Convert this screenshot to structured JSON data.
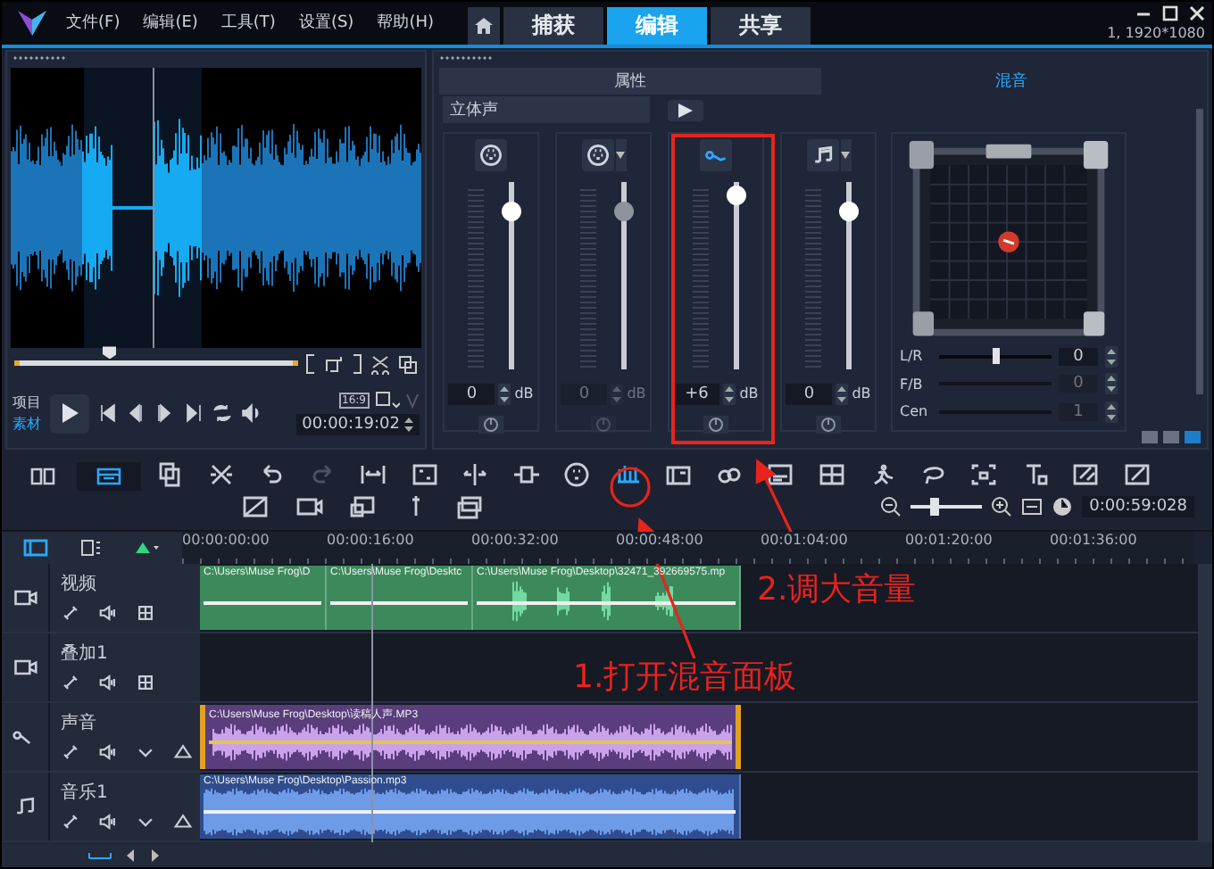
{
  "menu": [
    {
      "label": "文件(F)"
    },
    {
      "label": "编辑(E)"
    },
    {
      "label": "工具(T)"
    },
    {
      "label": "设置(S)"
    },
    {
      "label": "帮助(H)"
    }
  ],
  "tabs": [
    {
      "label": "捕获",
      "selected": false
    },
    {
      "label": "编辑",
      "selected": true
    },
    {
      "label": "共享",
      "selected": false
    }
  ],
  "project_info": "1, 1920*1080",
  "preview": {
    "sources": [
      {
        "label": "项目",
        "selected": false
      },
      {
        "label": "素材",
        "selected": true
      }
    ],
    "scrub": {
      "level": 0.33
    },
    "aspect": "16:9",
    "timecode": "00:00:19:02"
  },
  "mixer": {
    "tabs": [
      {
        "label": "属性",
        "selected": false
      },
      {
        "label": "混音",
        "selected": true
      }
    ],
    "channel_mode": "立体声",
    "channels": [
      {
        "kind": "video",
        "level": 0.84,
        "value": "0",
        "unit": "dB",
        "disabled": false
      },
      {
        "kind": "overlay",
        "level": 0.84,
        "value": "0",
        "unit": "dB",
        "disabled": true
      },
      {
        "kind": "voice",
        "level": 0.92,
        "value": "+6",
        "unit": "dB",
        "disabled": false
      },
      {
        "kind": "music",
        "level": 0.84,
        "value": "0",
        "unit": "dB",
        "disabled": false
      }
    ],
    "surround": [
      {
        "label": "L/R",
        "value": "0",
        "disabled": false,
        "level": 0.5
      },
      {
        "label": "F/B",
        "value": "0",
        "disabled": true
      },
      {
        "label": "Cen",
        "value": "1",
        "disabled": true
      }
    ]
  },
  "views": [
    {
      "kind": "storyboard",
      "selected": false
    },
    {
      "kind": "timeline",
      "selected": true
    }
  ],
  "timeline": {
    "zoom": {
      "level": 0.34
    },
    "duration": "0:00:59:028",
    "ruler": [
      "00:00:00:00",
      "00:00:16:00",
      "00:00:32:00",
      "00:00:48:00",
      "00:01:04:00",
      "00:01:20:00",
      "00:01:36:00"
    ],
    "tracks": [
      {
        "name": "视频",
        "kind": "video",
        "clips": [
          {
            "label": "C:\\Users\\Muse Frog\\D",
            "selected": false
          },
          {
            "label": "C:\\Users\\Muse Frog\\Desktc",
            "selected": false
          },
          {
            "label": "C:\\Users\\Muse Frog\\Desktop\\32471_392669575.mp",
            "selected": false
          }
        ]
      },
      {
        "name": "叠加1",
        "kind": "overlay"
      },
      {
        "name": "声音",
        "kind": "voice",
        "clips": [
          {
            "label": "C:\\Users\\Muse Frog\\Desktop\\读稿人声.MP3",
            "selected": true
          }
        ]
      },
      {
        "name": "音乐1",
        "kind": "music",
        "clips": [
          {
            "label": "C:\\Users\\Muse Frog\\Desktop\\Passion.mp3",
            "selected": false
          }
        ]
      }
    ]
  },
  "annotations": [
    {
      "text": "2.调大音量"
    },
    {
      "text": "1.打开混音面板"
    }
  ]
}
